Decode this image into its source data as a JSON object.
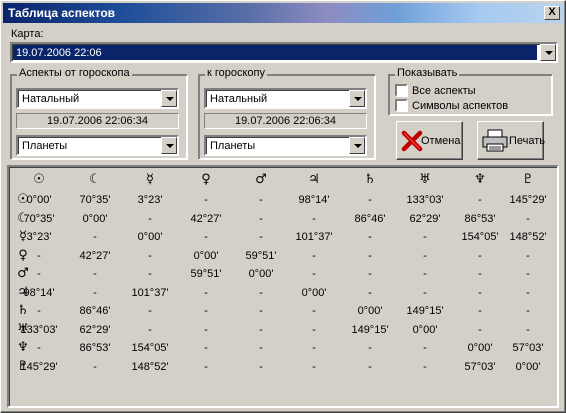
{
  "window": {
    "title": "Таблица аспектов",
    "close_label": "X"
  },
  "chart": {
    "label": "Карта:",
    "value": "19.07.2006 22:06"
  },
  "aspects_from": {
    "title": "Аспекты от гороскопа",
    "type_value": "Натальный",
    "date": "19.07.2006 22:06:34",
    "objects_value": "Планеты"
  },
  "aspects_to": {
    "title": "к гороскопу",
    "type_value": "Натальный",
    "date": "19.07.2006 22:06:34",
    "objects_value": "Планеты"
  },
  "show": {
    "title": "Показывать",
    "all_aspects_label": "Все аспекты",
    "symbols_label": "Символы аспектов"
  },
  "buttons": {
    "cancel": "Отмена",
    "print": "Печать"
  },
  "table": {
    "planets": [
      {
        "name": "sun",
        "symbol": "☉"
      },
      {
        "name": "moon",
        "symbol": "☾"
      },
      {
        "name": "mercury",
        "symbol": "☿"
      },
      {
        "name": "venus",
        "symbol": "♀"
      },
      {
        "name": "mars",
        "symbol": "♂"
      },
      {
        "name": "jupiter",
        "symbol": "♃"
      },
      {
        "name": "saturn",
        "symbol": "♄"
      },
      {
        "name": "uranus",
        "symbol": "♅"
      },
      {
        "name": "neptune",
        "symbol": "♆"
      },
      {
        "name": "pluto",
        "symbol": "♇"
      }
    ],
    "rows": [
      [
        "0°00'",
        "70°35'",
        "3°23'",
        "-",
        "-",
        "98°14'",
        "-",
        "133°03'",
        "-",
        "145°29'"
      ],
      [
        "70°35'",
        "0°00'",
        "-",
        "42°27'",
        "-",
        "-",
        "86°46'",
        "62°29'",
        "86°53'",
        "-"
      ],
      [
        "3°23'",
        "-",
        "0°00'",
        "-",
        "-",
        "101°37'",
        "-",
        "-",
        "154°05'",
        "148°52'"
      ],
      [
        "-",
        "42°27'",
        "-",
        "0°00'",
        "59°51'",
        "-",
        "-",
        "-",
        "-",
        "-"
      ],
      [
        "-",
        "-",
        "-",
        "59°51'",
        "0°00'",
        "-",
        "-",
        "-",
        "-",
        "-"
      ],
      [
        "98°14'",
        "-",
        "101°37'",
        "-",
        "-",
        "0°00'",
        "-",
        "-",
        "-",
        "-"
      ],
      [
        "-",
        "86°46'",
        "-",
        "-",
        "-",
        "-",
        "0°00'",
        "149°15'",
        "-",
        "-"
      ],
      [
        "133°03'",
        "62°29'",
        "-",
        "-",
        "-",
        "-",
        "149°15'",
        "0°00'",
        "-",
        "-"
      ],
      [
        "-",
        "86°53'",
        "154°05'",
        "-",
        "-",
        "-",
        "-",
        "-",
        "0°00'",
        "57°03'"
      ],
      [
        "145°29'",
        "-",
        "148°52'",
        "-",
        "-",
        "-",
        "-",
        "-",
        "57°03'",
        "0°00'"
      ]
    ]
  }
}
